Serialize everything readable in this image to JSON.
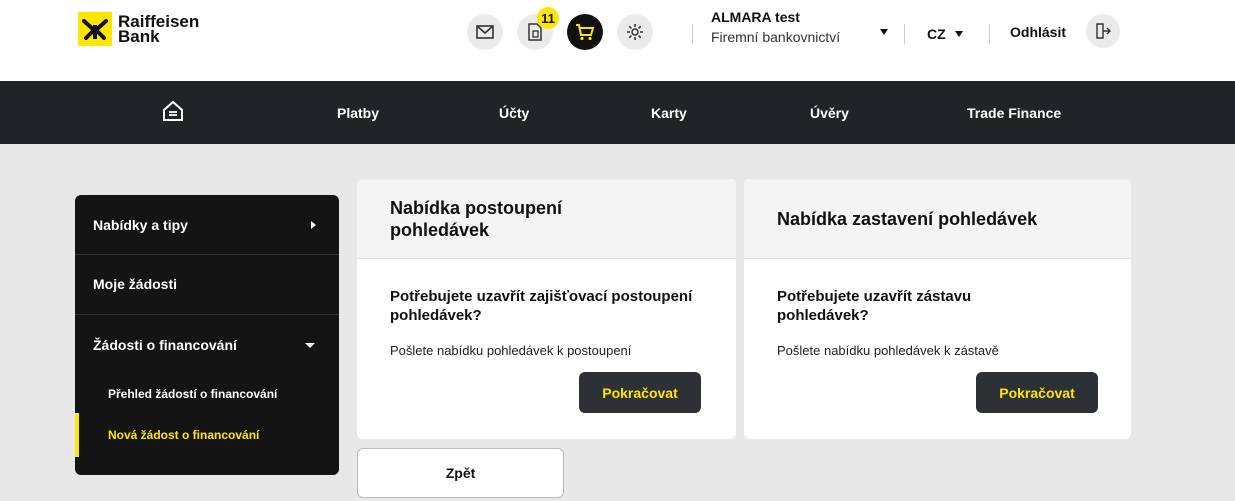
{
  "header": {
    "logo": {
      "line1": "Raiffeisen",
      "line2": "Bank",
      "brand_color": "#fee600"
    },
    "icons": {
      "mail": "mail-icon",
      "documents": "documents-icon",
      "cart": "cart-icon",
      "settings": "gear-icon"
    },
    "documents_badge": "11",
    "user": {
      "name": "ALMARA test",
      "segment": "Firemní bankovnictví"
    },
    "language": "CZ",
    "logout_label": "Odhlásit"
  },
  "nav": {
    "home_icon": "home-icon",
    "items": [
      "Platby",
      "Účty",
      "Karty",
      "Úvěry",
      "Trade Finance"
    ]
  },
  "sidebar": {
    "items": [
      "Nabídky a tipy",
      "Moje žádosti",
      "Žádosti o financování"
    ],
    "subitems": [
      "Přehled žádostí o financování",
      "Nová žádost o financování"
    ],
    "active_subitem": "Nová žádost o financování"
  },
  "cards": [
    {
      "title": "Nabídka postoupení pohledávek",
      "question": "Potřebujete uzavřít zajišťovací postoupení pohledávek?",
      "description": "Pošlete nabídku pohledávek k postoupení",
      "button": "Pokračovat"
    },
    {
      "title": "Nabídka zastavení pohledávek",
      "question": "Potřebujete uzavřít zástavu pohledávek?",
      "description": "Pošlete nabídku pohledávek k zástavě",
      "button": "Pokračovat"
    }
  ],
  "back_button": "Zpět",
  "colors": {
    "accent": "#fee600",
    "nav_bg": "#212426",
    "sidebar_bg": "#141414",
    "page_bg": "#e8e8e8"
  }
}
